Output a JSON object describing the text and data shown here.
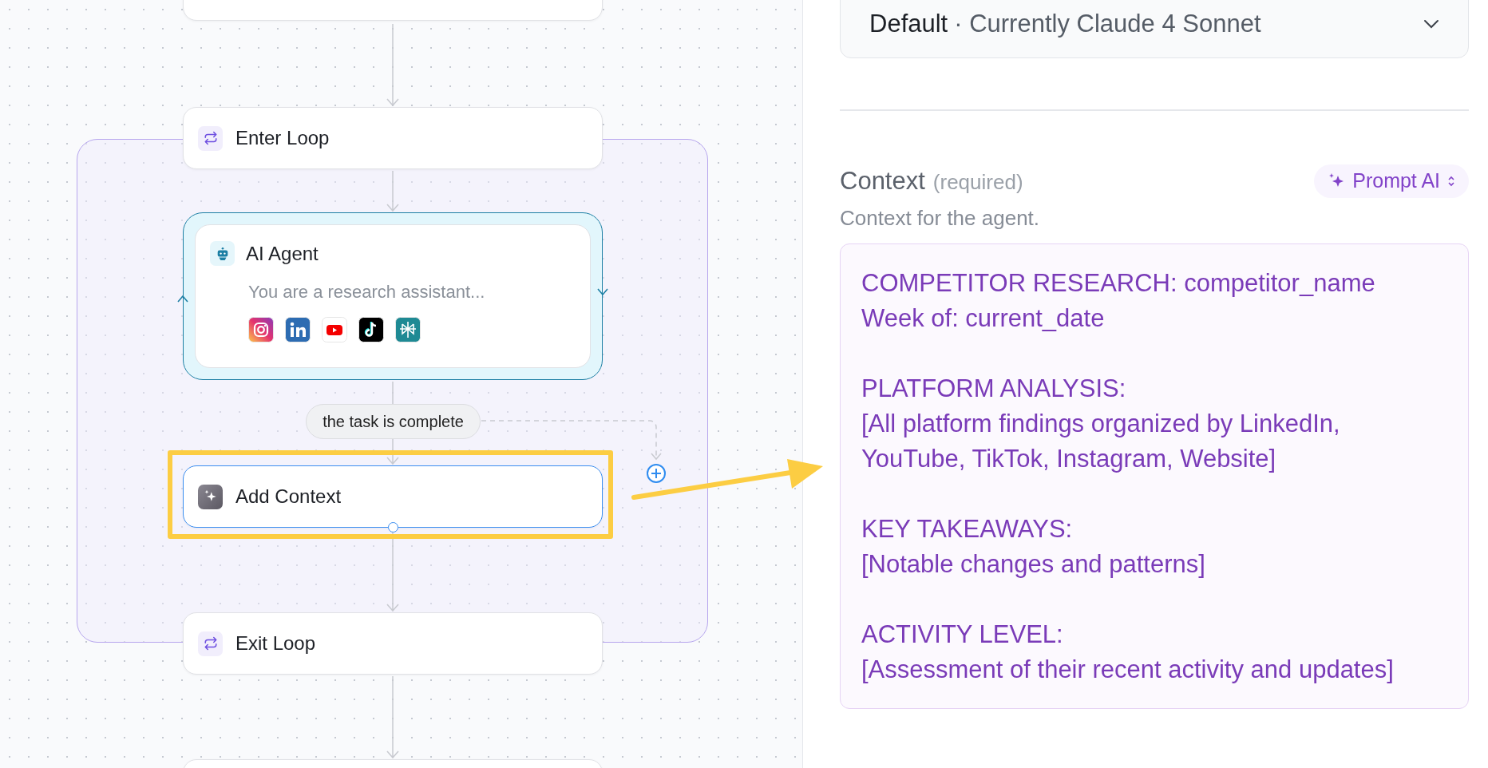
{
  "canvas": {
    "enter_loop": {
      "title": "Enter Loop"
    },
    "ai_agent": {
      "title": "AI Agent",
      "prompt": "You are a research assistant..."
    },
    "condition": {
      "label": "the task is complete"
    },
    "add_context": {
      "title": "Add Context",
      "selected": true,
      "highlighted": true
    },
    "exit_loop": {
      "title": "Exit Loop"
    }
  },
  "panel": {
    "model_select": {
      "value": "Default",
      "detail": "· Currently Claude 4 Sonnet"
    },
    "context": {
      "label": "Context",
      "required": "(required)",
      "prompt_button": "Prompt AI",
      "description": "Context for the agent.",
      "value": "COMPETITOR RESEARCH: competitor_name\nWeek of: current_date\n\nPLATFORM ANALYSIS:\n[All platform findings organized by LinkedIn, YouTube, TikTok, Instagram, Website]\n\nKEY TAKEAWAYS:\n[Notable changes and patterns]\n\nACTIVITY LEVEL:\n[Assessment of their recent activity and updates]"
    }
  }
}
